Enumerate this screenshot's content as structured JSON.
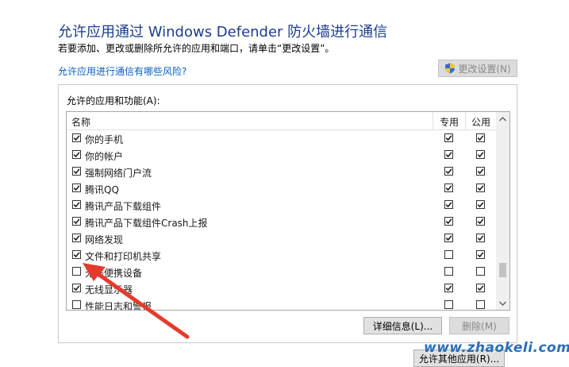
{
  "title": "允许应用通过 Windows Defender 防火墙进行通信",
  "subtitle": "若要添加、更改或删除所允许的应用和端口，请单击“更改设置”。",
  "risk_link": "允许应用进行通信有哪些风险?",
  "change_settings": {
    "label": "更改设置(N)",
    "icon": "uac-shield-icon"
  },
  "group_label": "允许的应用和功能(A):",
  "columns": {
    "name": "名称",
    "private": "专用",
    "public": "公用"
  },
  "rows": [
    {
      "name": "你的手机",
      "enabled": true,
      "private": true,
      "public": true
    },
    {
      "name": "你的帐户",
      "enabled": true,
      "private": true,
      "public": true
    },
    {
      "name": "强制网络门户流",
      "enabled": true,
      "private": true,
      "public": true
    },
    {
      "name": "腾讯QQ",
      "enabled": true,
      "private": true,
      "public": true
    },
    {
      "name": "腾讯产品下载组件",
      "enabled": true,
      "private": true,
      "public": true
    },
    {
      "name": "腾讯产品下载组件Crash上报",
      "enabled": true,
      "private": true,
      "public": true
    },
    {
      "name": "网络发现",
      "enabled": true,
      "private": true,
      "public": true
    },
    {
      "name": "文件和打印机共享",
      "enabled": true,
      "private": false,
      "public": true
    },
    {
      "name": "无线便携设备",
      "enabled": false,
      "private": false,
      "public": false
    },
    {
      "name": "无线显示器",
      "enabled": true,
      "private": true,
      "public": true
    },
    {
      "name": "性能日志和警报",
      "enabled": false,
      "private": false,
      "public": false
    }
  ],
  "buttons": {
    "details": "详细信息(L)...",
    "delete": "删除(M)",
    "allow_other": "允许其他应用(R)..."
  },
  "watermark": "www.zhaokeli.com",
  "colors": {
    "title": "#1a3d8f",
    "link": "#0a5fc2",
    "arrow": "#e53b2c",
    "watermark": "#2a6fb8"
  }
}
